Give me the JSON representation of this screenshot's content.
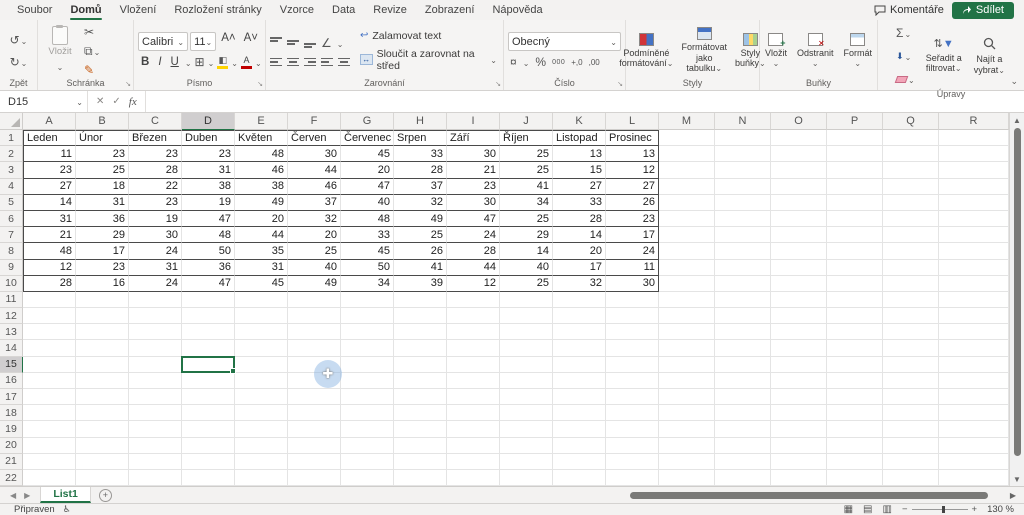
{
  "colors": {
    "accent_green": "#217346",
    "selection_border": "#217346",
    "fill_yellow": "#ffd400",
    "font_red": "#c00000",
    "header_selected": "#d0cecf"
  },
  "menu": {
    "items": [
      {
        "label": "Soubor"
      },
      {
        "label": "Domů"
      },
      {
        "label": "Vložení"
      },
      {
        "label": "Rozložení stránky"
      },
      {
        "label": "Vzorce"
      },
      {
        "label": "Data"
      },
      {
        "label": "Revize"
      },
      {
        "label": "Zobrazení"
      },
      {
        "label": "Nápověda"
      }
    ],
    "active": "Domů"
  },
  "titlebar": {
    "comments_label": "Komentáře",
    "share_label": "Sdílet"
  },
  "ribbon": {
    "undo": {
      "group_label": "Zpět"
    },
    "clipboard": {
      "group_label": "Schránka",
      "paste_label": "Vložit"
    },
    "font": {
      "group_label": "Písmo",
      "font_name": "Calibri",
      "font_size": "11",
      "bold": "B",
      "italic": "I",
      "underline": "U"
    },
    "alignment": {
      "group_label": "Zarovnání",
      "wrap_label": "Zalamovat text",
      "merge_label": "Sloučit a zarovnat na střed"
    },
    "number": {
      "group_label": "Číslo",
      "format": "Obecný",
      "percent": "%",
      "thousands": "000",
      "inc_decimal": "+,0",
      "dec_decimal": ",00"
    },
    "styles": {
      "group_label": "Styly",
      "conditional_line1": "Podmíněné",
      "conditional_line2": "formátování",
      "table_line1": "Formátovat",
      "table_line2": "jako tabulku",
      "cellstyles_line1": "Styly",
      "cellstyles_line2": "buňky"
    },
    "cells": {
      "group_label": "Buňky",
      "insert": "Vložit",
      "delete": "Odstranit",
      "format": "Formát"
    },
    "editing": {
      "group_label": "Úpravy",
      "sum": "Σ",
      "sort_line1": "Seřadit a",
      "sort_line2": "filtrovat",
      "find_line1": "Najít a",
      "find_line2": "vybrat"
    }
  },
  "formula_bar": {
    "name_box": "D15",
    "fx": "fx",
    "formula_value": ""
  },
  "spreadsheet": {
    "columns": [
      "A",
      "B",
      "C",
      "D",
      "E",
      "F",
      "G",
      "H",
      "I",
      "J",
      "K",
      "L",
      "M",
      "N",
      "O",
      "P",
      "Q",
      "R"
    ],
    "selected_column": "D",
    "selected_row": 15,
    "selected_cell": "D15",
    "visible_rows": 22,
    "header_row": [
      "Leden",
      "Únor",
      "Březen",
      "Duben",
      "Květen",
      "Červen",
      "Červenec",
      "Srpen",
      "Září",
      "Říjen",
      "Listopad",
      "Prosinec"
    ],
    "rows": [
      [
        11,
        23,
        23,
        23,
        48,
        30,
        45,
        33,
        30,
        25,
        13,
        13
      ],
      [
        23,
        25,
        28,
        31,
        46,
        44,
        20,
        28,
        21,
        25,
        15,
        12
      ],
      [
        27,
        18,
        22,
        38,
        38,
        46,
        47,
        37,
        23,
        41,
        27,
        27
      ],
      [
        14,
        31,
        23,
        19,
        49,
        37,
        40,
        32,
        30,
        34,
        33,
        26
      ],
      [
        31,
        36,
        19,
        47,
        20,
        32,
        48,
        49,
        47,
        25,
        28,
        23
      ],
      [
        21,
        29,
        30,
        48,
        44,
        20,
        33,
        25,
        24,
        29,
        14,
        17
      ],
      [
        48,
        17,
        24,
        50,
        35,
        25,
        45,
        26,
        28,
        14,
        20,
        24
      ],
      [
        12,
        23,
        31,
        36,
        31,
        40,
        50,
        41,
        44,
        40,
        17,
        11
      ],
      [
        28,
        16,
        24,
        47,
        45,
        49,
        34,
        39,
        12,
        25,
        32,
        30
      ]
    ]
  },
  "sheet_tabs": {
    "active_tab": "List1"
  },
  "status_bar": {
    "mode": "Připraven",
    "zoom": "130 %"
  }
}
